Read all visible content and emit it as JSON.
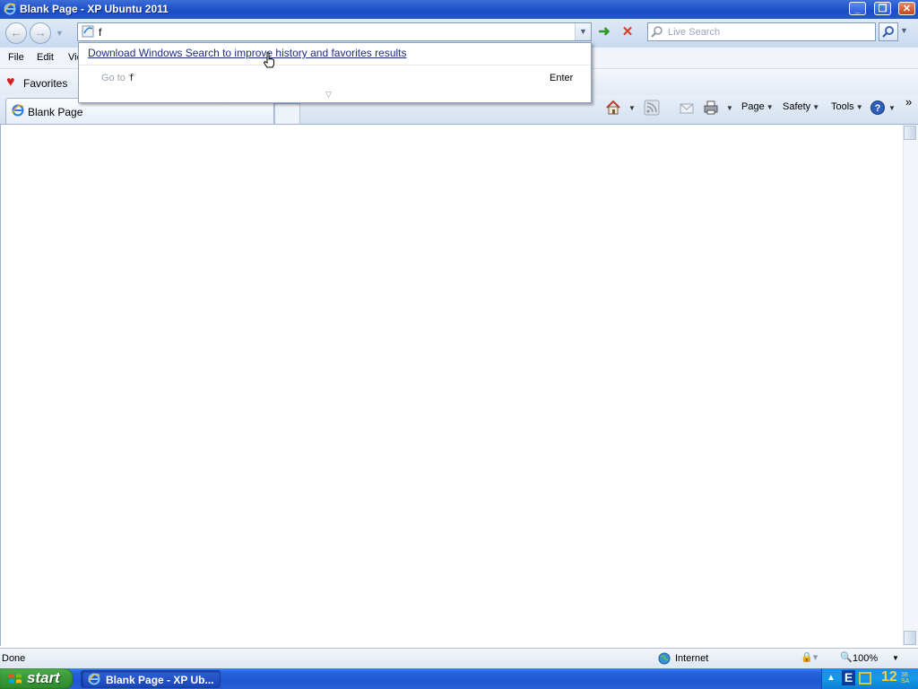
{
  "window": {
    "title": "Blank Page - XP Ubuntu 2011",
    "controls": {
      "minimize": "_",
      "maximize": "❐",
      "close": "✕"
    }
  },
  "navigation": {
    "address_value": "f",
    "search_placeholder": "Live Search",
    "go_glyph": "➜",
    "stop_glyph": "✕"
  },
  "address_popup": {
    "link_text": "Download Windows Search to improve history and favorites results",
    "goto_prefix": "Go to '",
    "goto_value": "f",
    "goto_suffix": "'",
    "enter_label": "Enter"
  },
  "menu": {
    "items": [
      "File",
      "Edit",
      "Vie"
    ]
  },
  "favorites_bar": {
    "label": "Favorites"
  },
  "tabs": [
    {
      "label": "Blank Page",
      "active": true
    }
  ],
  "command_bar": {
    "page": "Page",
    "safety": "Safety",
    "tools": "Tools",
    "more": "»"
  },
  "status_bar": {
    "status": "Done",
    "zone": "Internet",
    "zoom": "100%"
  },
  "taskbar": {
    "start_label": "start",
    "task_label": "Blank Page - XP Ub...",
    "clock": "12",
    "clock_suffix_1": "38",
    "clock_suffix_2": "SA",
    "tray_e": "E"
  },
  "colors": {
    "titlebar": "#2456c8",
    "start_button": "#3a9a3a",
    "taskbar": "#1f57d2",
    "link": "#1c2a88"
  }
}
